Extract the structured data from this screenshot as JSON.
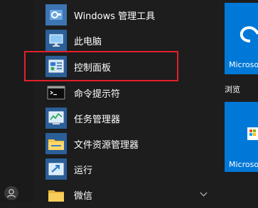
{
  "start_menu": {
    "app_list": [
      {
        "label": "Windows 管理工具",
        "icon": "windows-tools-icon"
      },
      {
        "label": "此电脑",
        "icon": "this-pc-icon"
      },
      {
        "label": "控制面板",
        "icon": "control-panel-icon",
        "highlighted": true
      },
      {
        "label": "命令提示符",
        "icon": "command-prompt-icon"
      },
      {
        "label": "任务管理器",
        "icon": "task-manager-icon"
      },
      {
        "label": "文件资源管理器",
        "icon": "file-explorer-icon"
      },
      {
        "label": "运行",
        "icon": "run-icon"
      },
      {
        "label": "微信",
        "icon": "folder-icon",
        "expandable": true
      }
    ],
    "tiles": {
      "top_label": "Microso",
      "browse_label": "浏览",
      "bottom_label": "Microso"
    }
  },
  "colors": {
    "background": "#1d1d1d",
    "tile_blue": "#0078d7",
    "highlight_border": "#e3202b",
    "icon_blue": "#2b5f98"
  }
}
